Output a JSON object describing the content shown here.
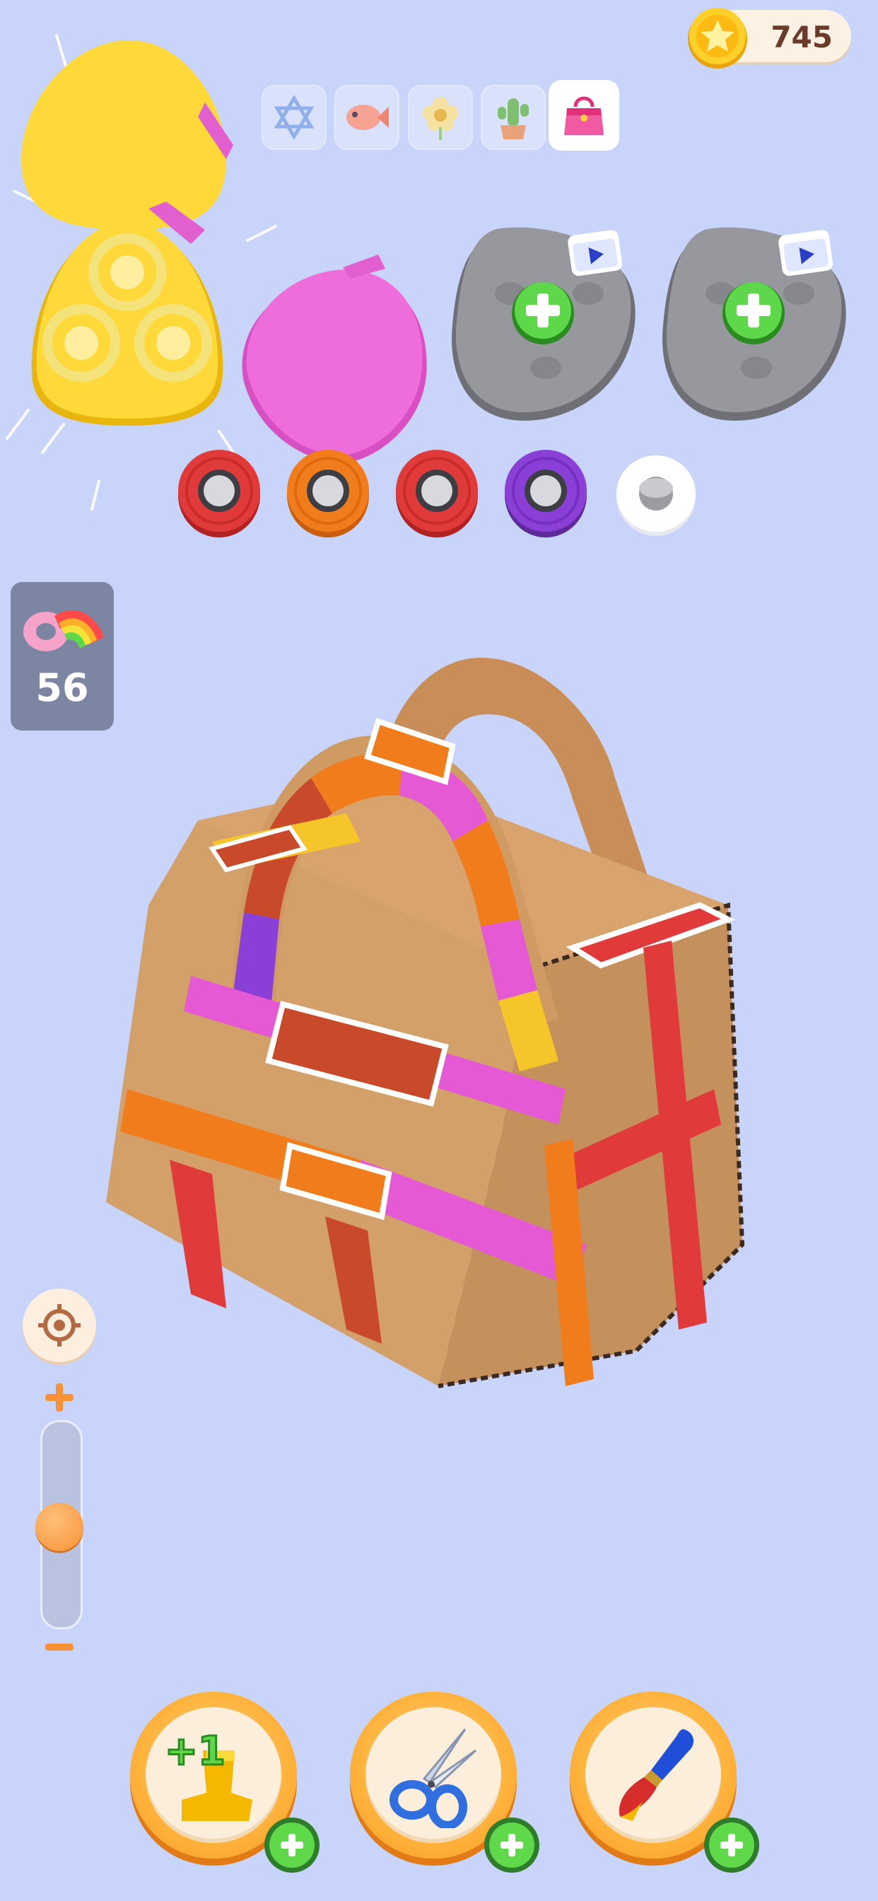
{
  "hud": {
    "coins": "745",
    "tape_count": "56"
  },
  "tabs": [
    {
      "name": "star-of-david",
      "icon": "star-of-david-icon",
      "active": false
    },
    {
      "name": "fish",
      "icon": "fish-icon",
      "active": false
    },
    {
      "name": "flower",
      "icon": "flower-icon",
      "active": false
    },
    {
      "name": "cactus",
      "icon": "cactus-icon",
      "active": false
    },
    {
      "name": "handbag",
      "icon": "handbag-icon",
      "active": true
    }
  ],
  "slots": [
    {
      "state": "filled",
      "color": "#ffd83a"
    },
    {
      "state": "filled",
      "color": "#f06ad9"
    },
    {
      "state": "locked-ad",
      "color": "#8e8e94"
    },
    {
      "state": "locked-ad",
      "color": "#8e8e94"
    }
  ],
  "spools": [
    {
      "color": "#e03a3a"
    },
    {
      "color": "#f07c1c"
    },
    {
      "color": "#e03a3a"
    },
    {
      "color": "#8a3fd6"
    },
    {
      "color": "#ffffff",
      "empty": true
    }
  ],
  "zoom_level": 0.5,
  "tools": [
    {
      "name": "extra-stamp",
      "icon": "stamp-plus-one-icon"
    },
    {
      "name": "scissors",
      "icon": "scissors-icon"
    },
    {
      "name": "paint-brush",
      "icon": "brush-icon"
    }
  ],
  "colors": {
    "background": "#c9d4fb",
    "cardboard": "#d4a06a",
    "accent_orange": "#ffb33c",
    "plus_green": "#5fd84a"
  }
}
